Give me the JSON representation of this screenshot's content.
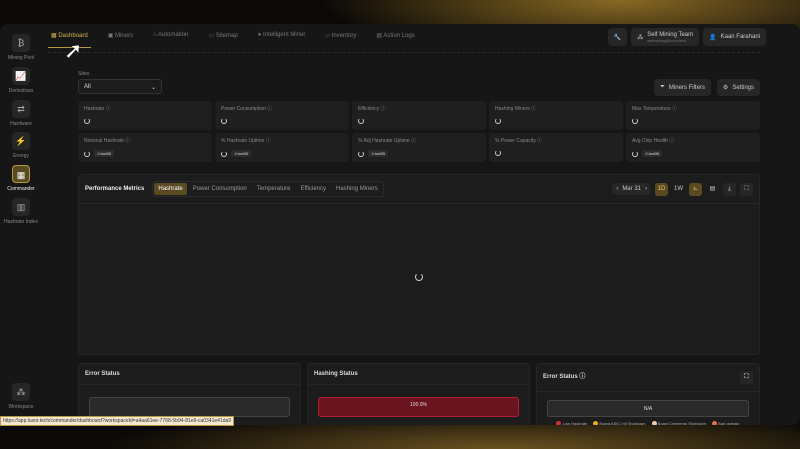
{
  "sidebar": {
    "items": [
      {
        "label": "Mining Pool",
        "icon": "₿"
      },
      {
        "label": "Derivatives",
        "icon": "📈"
      },
      {
        "label": "Hardware",
        "icon": "⇄"
      },
      {
        "label": "Energy",
        "icon": "⚡"
      },
      {
        "label": "Commander",
        "icon": "▦"
      },
      {
        "label": "Hashrate Index",
        "icon": "▥"
      }
    ],
    "workspace": {
      "label": "Workspace",
      "icon": "⁂"
    }
  },
  "nav": {
    "tabs": [
      "Dashboard",
      "Miners",
      "Automation",
      "Sitemap",
      "Intelligent Miner",
      "Inventory",
      "Action Logs"
    ]
  },
  "header": {
    "team_name": "Self Mining Team",
    "team_email": "selfmining@luxor.tech",
    "user": "Kaan Farahani"
  },
  "filters": {
    "sites_label": "Sites",
    "sites_value": "All",
    "miners_filters": "Miners Filters",
    "settings": "Settings"
  },
  "cards": [
    {
      "label": "Hashrate"
    },
    {
      "label": "Power Consumption"
    },
    {
      "label": "Efficiency"
    },
    {
      "label": "Hashing Miners"
    },
    {
      "label": "Max Temperature"
    },
    {
      "label": "Nominal Hashrate",
      "badge": "⚠ton0B"
    },
    {
      "label": "% Hashrate Uptime",
      "badge": "⚠ton0B"
    },
    {
      "label": "% Adj Hashrate Uptime",
      "badge": "⚠ton0B"
    },
    {
      "label": "% Power Capacity"
    },
    {
      "label": "Avg Chip Health",
      "badge": "⚠ton0B"
    }
  ],
  "performance": {
    "title": "Performance Metrics",
    "tabs": [
      "Hashrate",
      "Power Consumption",
      "Temperature",
      "Efficiency",
      "Hashing Miners"
    ],
    "active_tab": "Hashrate",
    "date": "Mar 31",
    "ranges": [
      "1D",
      "1W"
    ],
    "active_range": "1D"
  },
  "bottom": {
    "error_status": "Error Status",
    "hashing_status": "Hashing Status",
    "hashing_value": "100.0%",
    "error_status2": "Error Status",
    "na": "N/A",
    "legend": [
      {
        "label": "Low Hashrate",
        "color": "#d0303a"
      },
      {
        "label": "Board ASIC Init Shutdown",
        "color": "#e0b020"
      },
      {
        "label": "Board Overtemp Shutdown",
        "color": "#f0c8b0"
      },
      {
        "label": "Bad domain",
        "color": "#e07050"
      }
    ]
  },
  "status_url": "https://app.luxor.tech/commander/dashboard?workspaceId=a4aa61ee-7768-5b94-81e9-ca0341e41da9"
}
